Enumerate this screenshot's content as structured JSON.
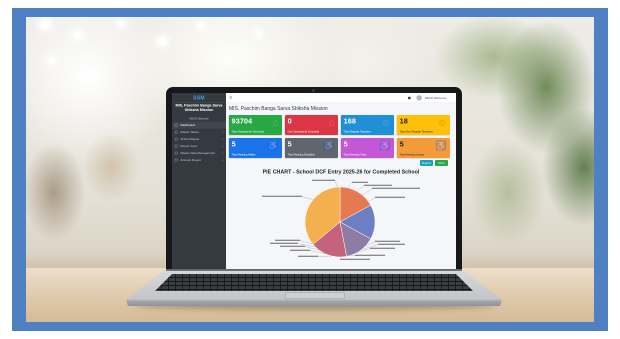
{
  "frame": {
    "color": "#4f80c2"
  },
  "screen": {
    "brand": "SSM",
    "sidebar": {
      "title": "MIS, Paschim Banga Sarva Shiksha Mission",
      "user": "ABCD Welcome",
      "items": [
        {
          "label": "Dashboard",
          "icon": "circle-icon",
          "chevron": ""
        },
        {
          "label": "Master Tables",
          "icon": "circle-icon",
          "chevron": "‹"
        },
        {
          "label": "School Report",
          "icon": "circle-icon",
          "chevron": "‹"
        },
        {
          "label": "Report Card",
          "icon": "circle-icon",
          "chevron": "‹"
        },
        {
          "label": "Master Data Management",
          "icon": "circle-icon",
          "chevron": "‹"
        },
        {
          "label": "Account Report",
          "icon": "circle-icon",
          "chevron": "‹"
        }
      ]
    },
    "topbar": {
      "menu_icon": "≡",
      "user_label": "ABCD Welcome"
    },
    "page_title": "MIS, Paschim Banga Sarva Shiksha Mission",
    "stat_cards": [
      {
        "value": "93704",
        "label": "Total Operational School(s)",
        "color": "#28a745",
        "text_color": "#ffffff",
        "icon": "⌂"
      },
      {
        "value": "0",
        "label": "Non Operational School(s)",
        "color": "#dc3545",
        "text_color": "#ffffff",
        "icon": "⌂"
      },
      {
        "value": "168",
        "label": "Total Regular Teachers",
        "color": "#1f8fd6",
        "text_color": "#ffffff",
        "icon": "☺"
      },
      {
        "value": "18",
        "label": "Total Non Regular Teachers",
        "color": "#ffc107",
        "text_color": "#212529",
        "icon": "☺"
      },
      {
        "value": "5",
        "label": "Total Hearing Walks",
        "color": "#1a73e8",
        "text_color": "#ffffff",
        "icon": "♿"
      },
      {
        "value": "5",
        "label": "Total Hearing Disability",
        "color": "#5f666d",
        "text_color": "#ffffff",
        "icon": "♿"
      },
      {
        "value": "5",
        "label": "Total Hearing Visits",
        "color": "#c457d6",
        "text_color": "#ffffff",
        "icon": "♿"
      },
      {
        "value": "5",
        "label": "Total Hearing Library",
        "color": "#f29b38",
        "text_color": "#212529",
        "icon": "♿"
      }
    ],
    "buttons": {
      "export": {
        "label": "Export",
        "color": "#17a2b8"
      },
      "print": {
        "label": "Print",
        "color": "#28a745"
      }
    }
  },
  "chart_data": {
    "type": "pie",
    "title": "PIE CHART - School DCF Entry 2025-26 for Completed School",
    "slices": [
      {
        "value": 0.17,
        "color": "#e67852"
      },
      {
        "value": 0.16,
        "color": "#6e7ec4"
      },
      {
        "value": 0.14,
        "color": "#8f7ba6"
      },
      {
        "value": 0.17,
        "color": "#c4637c"
      },
      {
        "value": 0.36,
        "color": "#f4b04e"
      }
    ]
  }
}
